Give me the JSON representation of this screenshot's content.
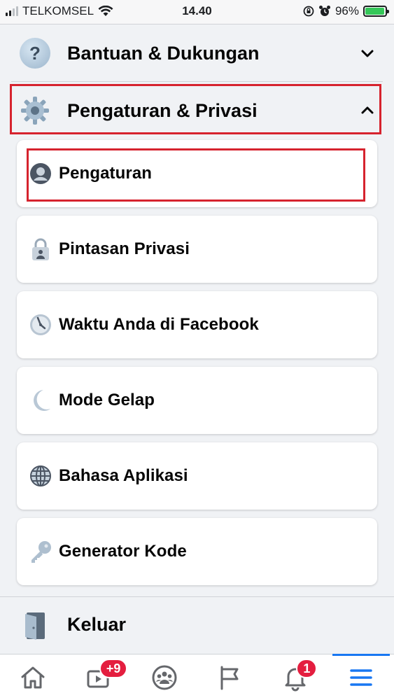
{
  "status_bar": {
    "carrier": "TELKOMSEL",
    "time": "14.40",
    "battery": "96%",
    "battery_level": 0.96
  },
  "menu": {
    "help_section": {
      "label": "Bantuan & Dukungan",
      "icon": "question-icon",
      "state": "collapsed"
    },
    "settings_section": {
      "label": "Pengaturan & Privasi",
      "icon": "gear-icon",
      "state": "expanded"
    },
    "items": [
      {
        "label": "Pengaturan",
        "icon": "profile-icon",
        "highlighted": true
      },
      {
        "label": "Pintasan Privasi",
        "icon": "lock-icon"
      },
      {
        "label": "Waktu Anda di Facebook",
        "icon": "clock-icon"
      },
      {
        "label": "Mode Gelap",
        "icon": "moon-icon"
      },
      {
        "label": "Bahasa Aplikasi",
        "icon": "globe-icon"
      },
      {
        "label": "Generator Kode",
        "icon": "key-icon"
      }
    ],
    "logout": {
      "label": "Keluar",
      "icon": "door-icon"
    }
  },
  "tab_bar": {
    "tabs": [
      {
        "name": "home",
        "icon": "home-icon"
      },
      {
        "name": "watch",
        "icon": "video-icon",
        "badge": "+9"
      },
      {
        "name": "groups",
        "icon": "groups-icon"
      },
      {
        "name": "pages",
        "icon": "flag-icon"
      },
      {
        "name": "notifications",
        "icon": "bell-icon",
        "badge": "1"
      },
      {
        "name": "menu",
        "icon": "hamburger-icon",
        "active": true
      }
    ]
  },
  "colors": {
    "highlight": "#d6232e",
    "accent": "#1877f2",
    "badge": "#e41e3f"
  }
}
